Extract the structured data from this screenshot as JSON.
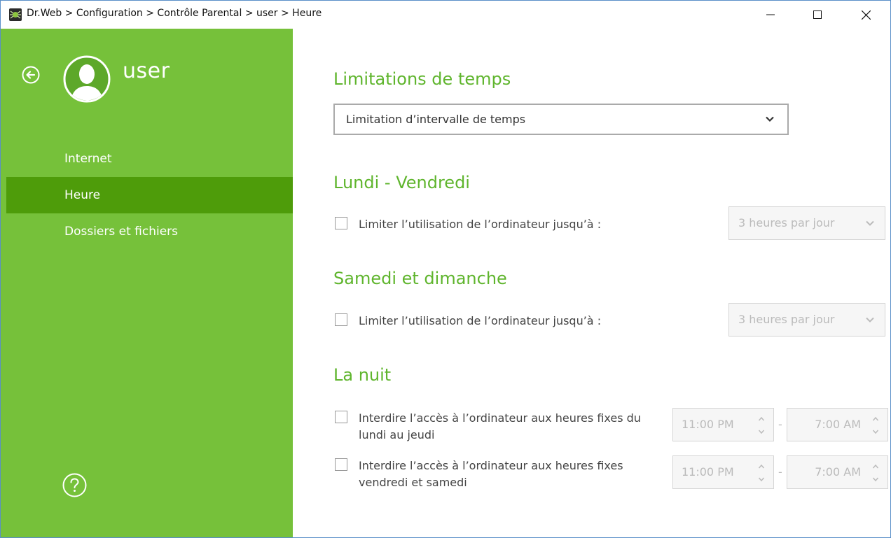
{
  "window": {
    "title": "Dr.Web > Configuration > Contrôle Parental > user > Heure",
    "controls": {
      "minimize": "—",
      "maximize": "☐",
      "close": "✕"
    }
  },
  "sidebar": {
    "username": "user",
    "items": [
      {
        "label": "Internet",
        "active": false
      },
      {
        "label": "Heure",
        "active": true
      },
      {
        "label": "Dossiers et fichiers",
        "active": false
      }
    ],
    "help_icon": "question-circle-icon",
    "back_icon": "arrow-left-circle-icon",
    "avatar_icon": "user-avatar-icon"
  },
  "main": {
    "time_limits": {
      "heading": "Limitations de temps",
      "mode_value": "Limitation d’intervalle de temps"
    },
    "weekdays": {
      "heading": "Lundi - Vendredi",
      "checkbox_label": "Limiter l’utilisation de l’ordinateur jusqu’à :",
      "checked": false,
      "limit_value": "3 heures par jour"
    },
    "weekend": {
      "heading": "Samedi et dimanche",
      "checkbox_label": "Limiter l’utilisation de l’ordinateur jusqu’à :",
      "checked": false,
      "limit_value": "3 heures par jour"
    },
    "night": {
      "heading": "La nuit",
      "rules": [
        {
          "label_line1": "Interdire l’accès à l’ordinateur aux heures fixes du",
          "label_line2": "lundi au jeudi",
          "checked": false,
          "from": "11:00 PM",
          "to": "7:00 AM"
        },
        {
          "label_line1": "Interdire l’accès à l’ordinateur aux heures fixes",
          "label_line2": "vendredi et samedi",
          "checked": false,
          "from": "11:00 PM",
          "to": "7:00 AM"
        }
      ],
      "separator": "-"
    }
  },
  "colors": {
    "sidebar_bg": "#76c13a",
    "sidebar_active": "#4e9c0a",
    "heading_green": "#5fb52d"
  }
}
